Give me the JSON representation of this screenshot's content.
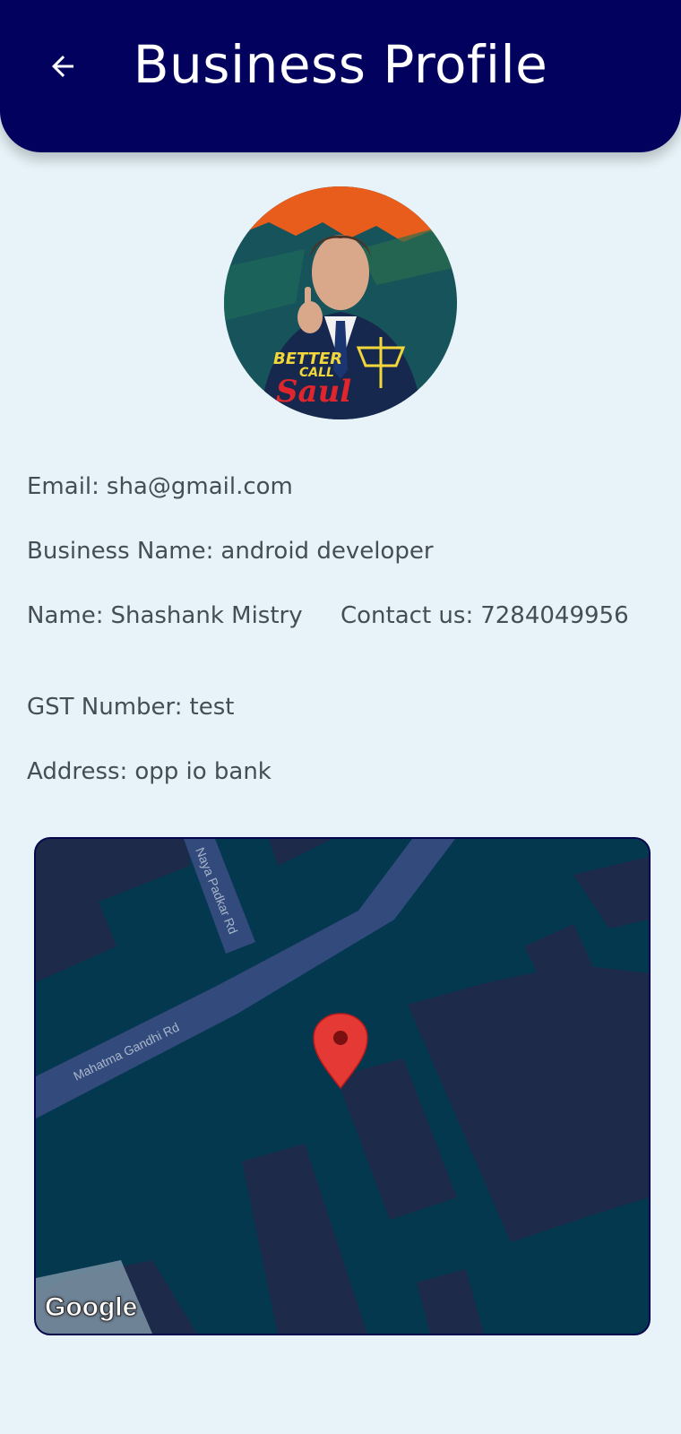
{
  "header": {
    "title": "Business Profile",
    "background": "#02025e",
    "back_icon": "arrow-left-icon"
  },
  "profile": {
    "avatar_caption": [
      "BETTER",
      "CALL",
      "Saul"
    ],
    "email_label": "Email:",
    "email": "sha@gmail.com",
    "business_name_label": "Business Name:",
    "business_name": "android developer",
    "name_label": "Name:",
    "name": "Shashank Mistry",
    "contact_label": "Contact us:",
    "contact": "7284049956",
    "gst_label": "GST Number:",
    "gst": "test",
    "address_label": "Address:",
    "address": "opp io bank"
  },
  "map": {
    "road_1": "Naya Padkar Rd",
    "road_2": "Mahatma Gandhi Rd",
    "attribution": "Google",
    "marker_color": "#e53935"
  }
}
